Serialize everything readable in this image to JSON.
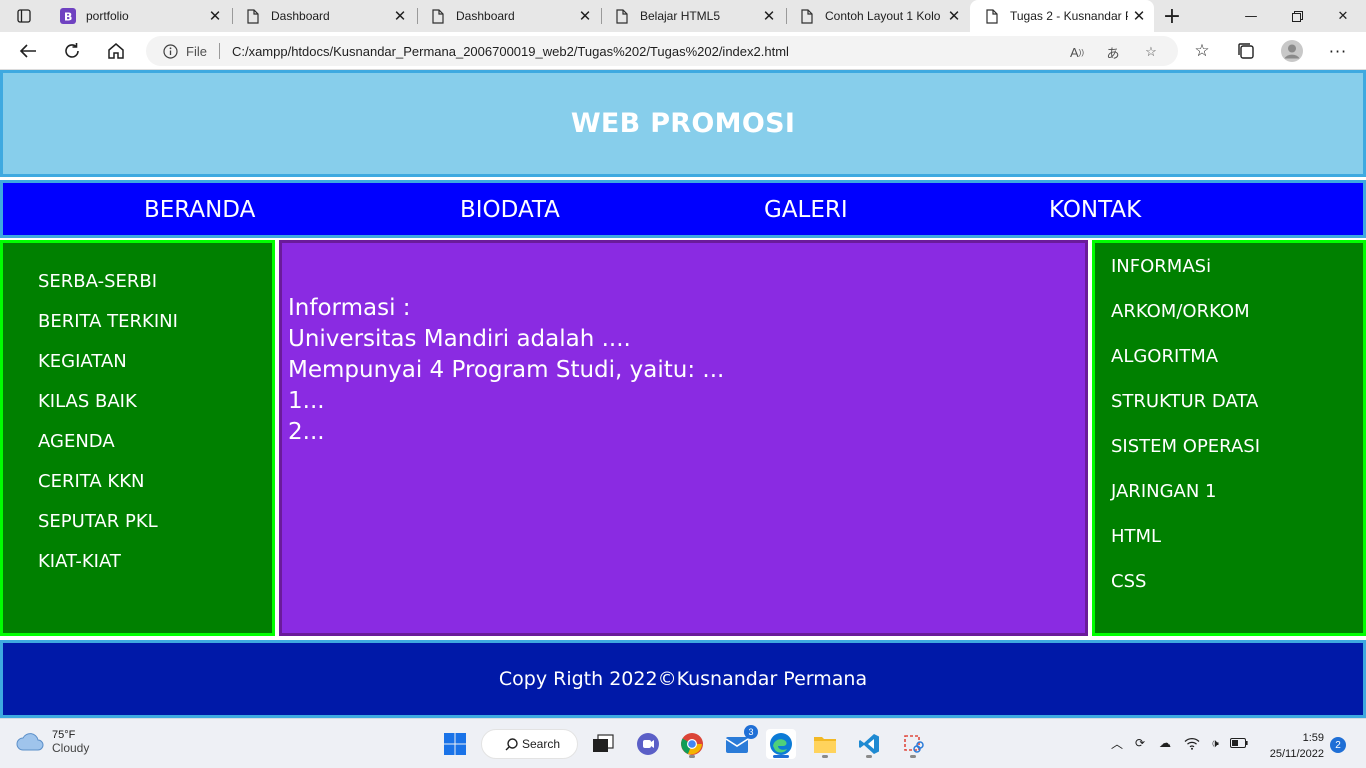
{
  "browser": {
    "tabs": [
      {
        "title": "portfolio",
        "icon": "bootstrap-b-icon"
      },
      {
        "title": "Dashboard",
        "icon": "page-icon"
      },
      {
        "title": "Dashboard",
        "icon": "page-icon"
      },
      {
        "title": "Belajar HTML5",
        "icon": "page-icon"
      },
      {
        "title": "Contoh Layout 1 Kolo",
        "icon": "page-icon"
      },
      {
        "title": "Tugas 2 - Kusnandar P",
        "icon": "page-icon",
        "active": true
      }
    ],
    "address": {
      "scheme_label": "File",
      "url": "C:/xampp/htdocs/Kusnandar_Permana_2006700019_web2/Tugas%202/Tugas%202/index2.html"
    }
  },
  "page": {
    "header_title": "WEB PROMOSI",
    "nav": [
      "BERANDA",
      "BIODATA",
      "GALERI",
      "KONTAK"
    ],
    "left_menu": [
      "SERBA-SERBI",
      "BERITA TERKINI",
      "KEGIATAN",
      "KILAS BAIK",
      "AGENDA",
      "CERITA KKN",
      "SEPUTAR PKL",
      "KIAT-KIAT"
    ],
    "content_lines": [
      "Informasi :",
      "Universitas Mandiri adalah ....",
      "Mempunyai 4 Program Studi, yaitu: ...",
      "1...",
      "2..."
    ],
    "right_menu": [
      "INFORMASi",
      "ARKOM/ORKOM",
      "ALGORITMA",
      "STRUKTUR DATA",
      "SISTEM OPERASI",
      "JARINGAN 1",
      "HTML",
      "CSS"
    ],
    "footer": "Copy Rigth 2022©Kusnandar Permana",
    "colors": {
      "header_bg": "#87ceeb",
      "nav_bg": "#0000ff",
      "sidebar_bg": "#008000",
      "sidebar_border": "#00ff00",
      "content_bg": "#8a2be2",
      "footer_bg": "#0019a8"
    }
  },
  "taskbar": {
    "weather_temp": "75°F",
    "weather_condition": "Cloudy",
    "search_label": "Search",
    "mail_badge": "3",
    "time": "1:59",
    "date": "25/11/2022",
    "notification_count": "2"
  }
}
